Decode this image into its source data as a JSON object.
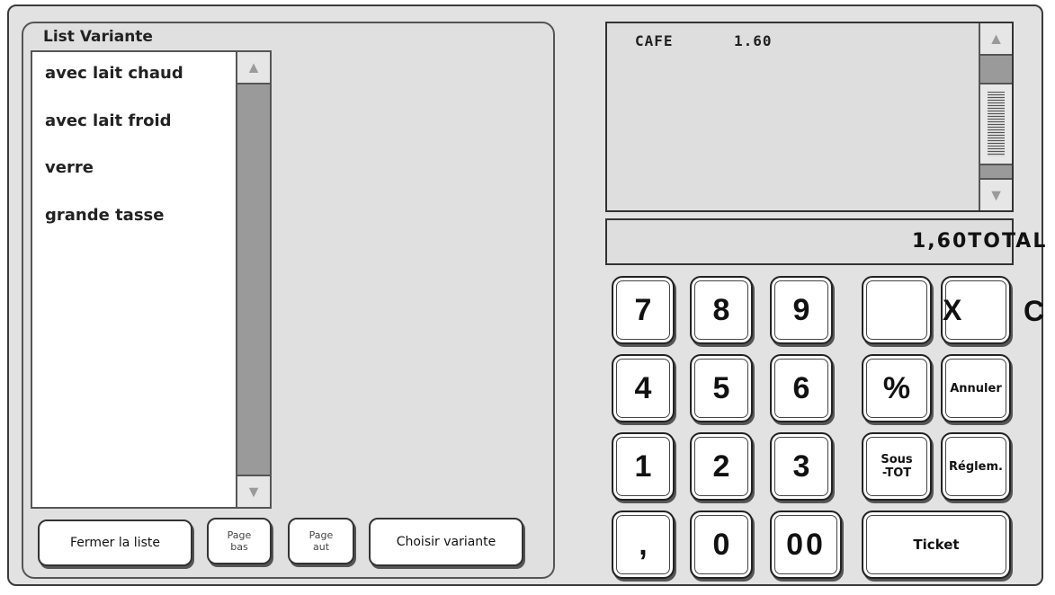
{
  "variant_panel": {
    "title": "List Variante",
    "items": [
      {
        "label": "avec lait chaud"
      },
      {
        "label": "avec lait froid"
      },
      {
        "label": "verre"
      },
      {
        "label": "grande tasse"
      }
    ],
    "scroll_up_glyph": "▲",
    "scroll_down_glyph": "▼",
    "buttons": {
      "close_label": "Fermer la liste",
      "page_down_line1": "Page",
      "page_down_line2": "bas",
      "page_up_line1": "Page",
      "page_up_line2": "aut",
      "choose_label": "Choisir variante"
    }
  },
  "ticket": {
    "lines": [
      {
        "name": "CAFE",
        "price": "1.60"
      }
    ],
    "scroll_up_glyph": "▲",
    "scroll_down_glyph": "▼"
  },
  "total": {
    "text": "1,60TOTAL"
  },
  "keypad": {
    "k7": "7",
    "k8": "8",
    "k9": "9",
    "k4": "4",
    "k5": "5",
    "k6": "6",
    "k1": "1",
    "k2": "2",
    "k3": "3",
    "comma": ",",
    "k0": "0",
    "k00": "00",
    "blank": "",
    "multiply": "X",
    "clear": "C",
    "percent": "%",
    "cancel": "Annuler",
    "subtotal_line1": "Sous",
    "subtotal_line2": "-TOT",
    "payment": "Réglem.",
    "ticket": "Ticket"
  },
  "colors": {
    "background": "#e2e2e2",
    "panel_border": "#555555",
    "scroll_track": "#9a9a9a",
    "key_face": "#ffffff"
  }
}
